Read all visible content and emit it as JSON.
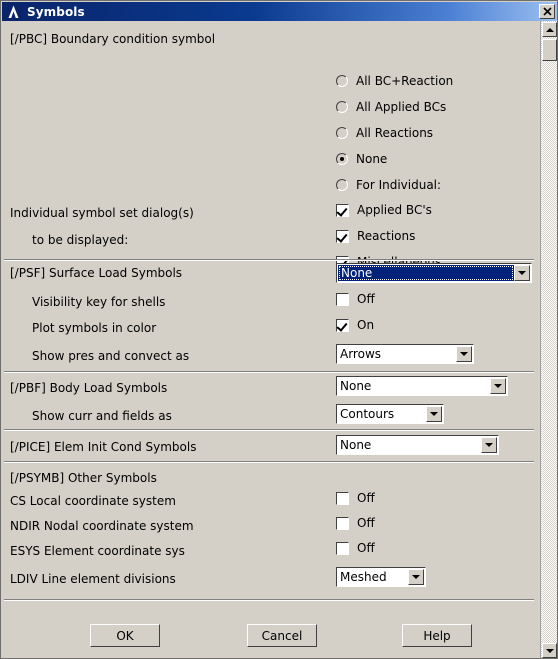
{
  "window": {
    "title": "Symbols",
    "logo_icon": "ansys-lambda-icon",
    "close_label": "✕"
  },
  "scrollbar": {
    "up_icon": "scroll-up-arrow-icon",
    "down_icon": "scroll-down-arrow-icon"
  },
  "pbc": {
    "heading": "[/PBC] Boundary condition symbol",
    "left_label_1": "Individual symbol set dialog(s)",
    "left_label_2": "to be displayed:",
    "radios": [
      {
        "label": "All BC+Reaction",
        "selected": false
      },
      {
        "label": "All Applied BCs",
        "selected": false
      },
      {
        "label": "All Reactions",
        "selected": false
      },
      {
        "label": "None",
        "selected": true
      },
      {
        "label": "For Individual:",
        "selected": false
      }
    ],
    "checkboxes": [
      {
        "label": "Applied BC's",
        "checked": true
      },
      {
        "label": "Reactions",
        "checked": true
      },
      {
        "label": "Miscellaneous",
        "checked": true
      }
    ]
  },
  "psf": {
    "heading": "[/PSF]  Surface Load Symbols",
    "symbols_value": "None",
    "rows": [
      {
        "label": "Visibility key for shells",
        "state": "Off",
        "checked": false
      },
      {
        "label": "Plot symbols in color",
        "state": "On",
        "checked": true
      }
    ],
    "show_pres_label": "Show pres and convect as",
    "show_pres_value": "Arrows"
  },
  "pbf": {
    "heading": "[/PBF]  Body Load Symbols",
    "symbols_value": "None",
    "show_curr_label": "Show curr and fields as",
    "show_curr_value": "Contours"
  },
  "pice": {
    "heading": "[/PICE] Elem Init Cond Symbols",
    "symbols_value": "None"
  },
  "psymb": {
    "heading": "[/PSYMB] Other Symbols",
    "rows": [
      {
        "label": "CS   Local coordinate system",
        "state": "Off",
        "checked": false
      },
      {
        "label": "NDIR Nodal coordinate system",
        "state": "Off",
        "checked": false
      },
      {
        "label": "ESYS Element coordinate sys",
        "state": "Off",
        "checked": false
      }
    ],
    "ldiv_label": "LDIV  Line element divisions",
    "ldiv_value": "Meshed"
  },
  "buttons": {
    "ok": "OK",
    "cancel": "Cancel",
    "help": "Help"
  },
  "colors": {
    "face": "#d4d0c8",
    "title_start": "#0a246a",
    "title_end": "#9cc0f0",
    "selection": "#00227a"
  }
}
